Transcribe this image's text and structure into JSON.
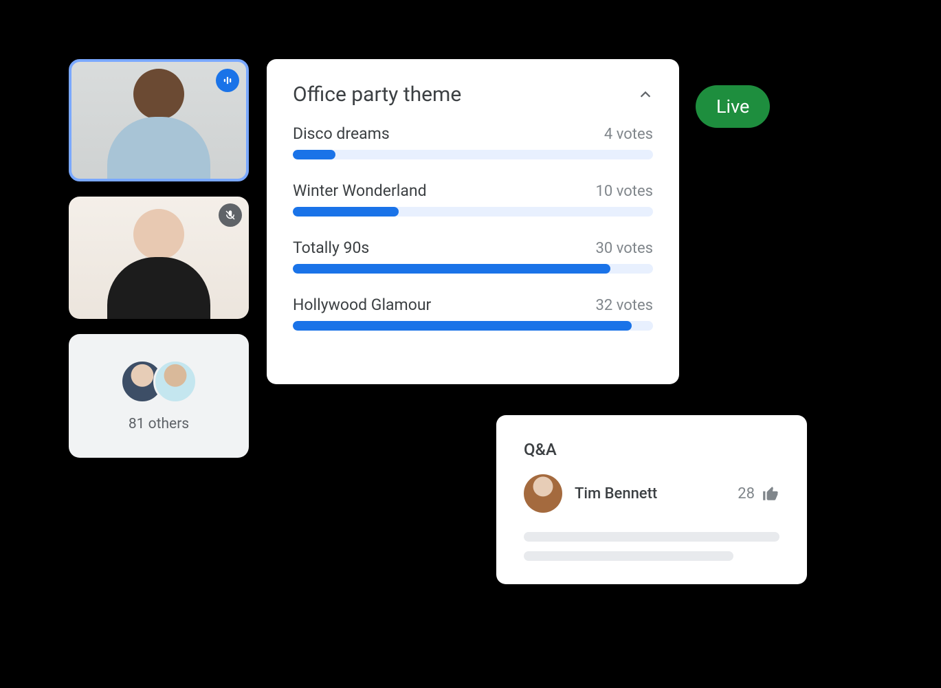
{
  "live_label": "Live",
  "others": {
    "count_text": "81 others",
    "avatars": [
      "av-a",
      "av-b"
    ]
  },
  "poll": {
    "title": "Office party theme",
    "max_votes": 34,
    "options": [
      {
        "label": "Disco dreams",
        "votes": 4,
        "votes_text": "4 votes"
      },
      {
        "label": "Winter Wonderland",
        "votes": 10,
        "votes_text": "10 votes"
      },
      {
        "label": "Totally 90s",
        "votes": 30,
        "votes_text": "30 votes"
      },
      {
        "label": "Hollywood Glamour",
        "votes": 32,
        "votes_text": "32 votes"
      }
    ]
  },
  "qa": {
    "title": "Q&A",
    "name": "Tim Bennett",
    "likes": "28"
  },
  "chart_data": {
    "type": "bar",
    "title": "Office party theme",
    "categories": [
      "Disco dreams",
      "Winter Wonderland",
      "Totally 90s",
      "Hollywood Glamour"
    ],
    "values": [
      4,
      10,
      30,
      32
    ],
    "xlabel": "",
    "ylabel": "votes",
    "ylim": [
      0,
      34
    ]
  }
}
